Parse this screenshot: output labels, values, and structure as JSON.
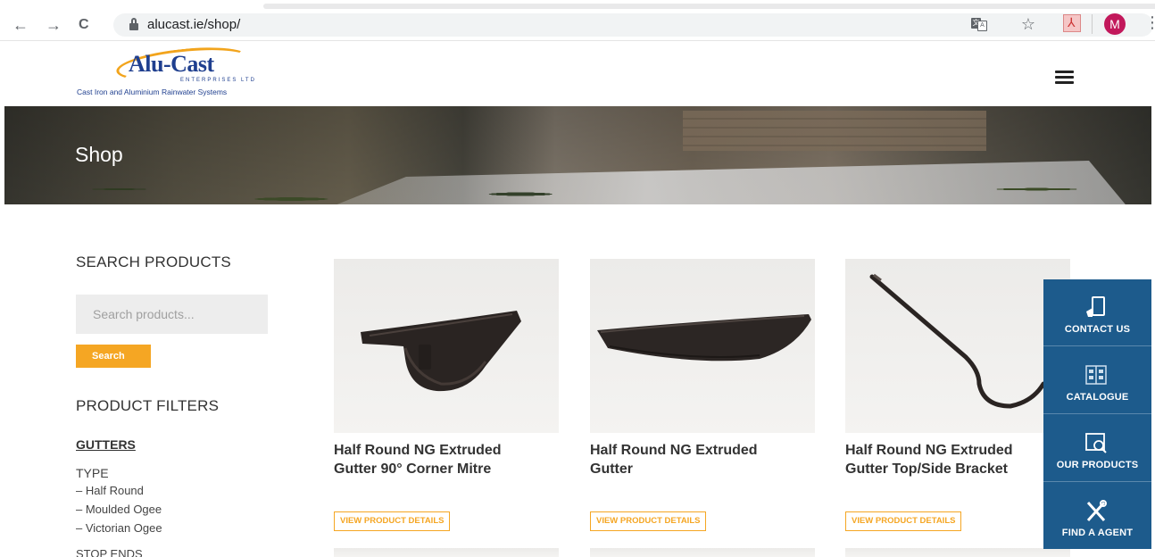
{
  "browser": {
    "url": "alucast.ie/shop/",
    "nav": {
      "back": "←",
      "forward": "→",
      "reload": "C"
    },
    "icons": [
      "translate-icon",
      "star-icon",
      "pdf-icon"
    ],
    "profile_initial": "M",
    "profile_color": "#c2185b",
    "menu": "⋮"
  },
  "site": {
    "logo_name": "Alu-Cast",
    "logo_sub": "ENTERPRISES LTD",
    "logo_tagline": "Cast Iron and Aluminium Rainwater Systems",
    "brand_color": "#1f3f8f",
    "accent_color": "#f5a623",
    "menu_icon": "hamburger-icon"
  },
  "hero": {
    "title": "Shop"
  },
  "sidebar": {
    "search_heading": "SEARCH PRODUCTS",
    "search_placeholder": "Search products...",
    "search_button": "Search",
    "filters_heading": "PRODUCT FILTERS",
    "category": "GUTTERS",
    "type_label": "TYPE",
    "type_items": [
      "– Half Round",
      "– Moulded Ogee",
      "– Victorian Ogee"
    ],
    "next_heading": "STOP ENDS"
  },
  "products": [
    {
      "title_line1": "Half Round NG Extruded",
      "title_line2": "Gutter 90° Corner Mitre",
      "button": "VIEW PRODUCT DETAILS"
    },
    {
      "title_line1": "Half Round NG Extruded",
      "title_line2": "Gutter",
      "button": "VIEW PRODUCT DETAILS"
    },
    {
      "title_line1": "Half Round NG Extruded",
      "title_line2": "Gutter Top/Side Bracket",
      "button": "VIEW PRODUCT DETAILS"
    }
  ],
  "float_panel": {
    "color": "#1d5b8c",
    "items": [
      {
        "label": "CONTACT US",
        "icon": "contact-icon"
      },
      {
        "label": "CATALOGUE",
        "icon": "catalogue-icon"
      },
      {
        "label": "OUR PRODUCTS",
        "icon": "products-search-icon"
      },
      {
        "label": "FIND A AGENT",
        "icon": "tools-icon"
      }
    ]
  }
}
